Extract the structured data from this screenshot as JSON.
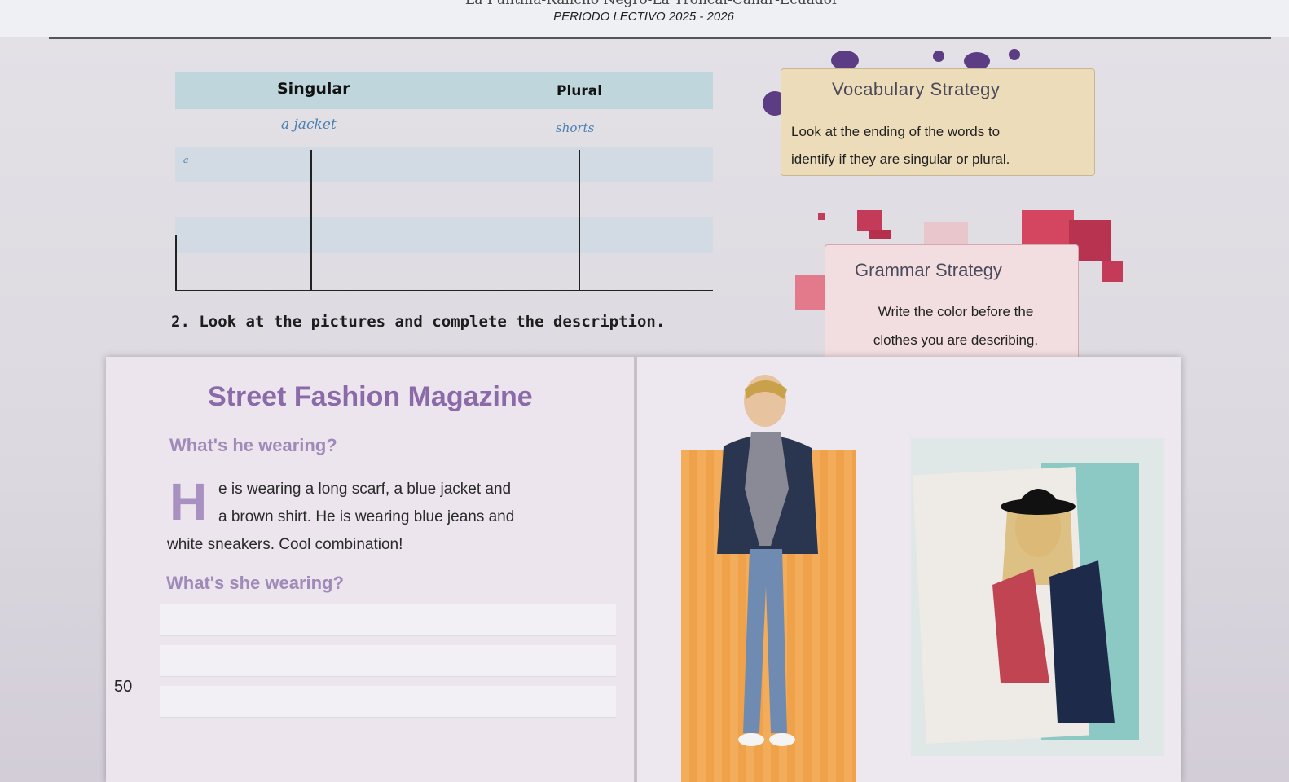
{
  "header": {
    "school_line": "La Puntilla-Rancho Negro-La Troncal-Cañar-Ecuador",
    "periodo": "PERIODO LECTIVO 2025 - 2026"
  },
  "table": {
    "col_singular": "Singular",
    "col_plural": "Plural",
    "example_singular": "a jacket",
    "example_plural": "shorts",
    "row_prefix": "a"
  },
  "vocab_strategy": {
    "title": "Vocabulary  Strategy",
    "line1": "Look at the ending of the words to",
    "line2": "identify if they are singular or plural."
  },
  "grammar_strategy": {
    "title": "Grammar  Strategy",
    "line1": "Write the color before the",
    "line2": "clothes you are describing."
  },
  "instruction": "2. Look at the pictures and complete the description.",
  "magazine": {
    "title": "Street Fashion Magazine",
    "question_he": "What's he wearing?",
    "dropcap": "H",
    "para_line1": "e is wearing a long scarf, a blue jacket and",
    "para_line2": "a brown shirt. He is wearing blue jeans and",
    "para_line3": "white sneakers. Cool combination!",
    "question_she": "What's she wearing?"
  },
  "page_number": "50",
  "colors": {
    "table_header": "#bfd6dc",
    "vocab_box": "#ecdcb9",
    "grammar_box": "#f2dde0",
    "magazine_title": "#8a6aa8",
    "accent_dots": "#5c3c82",
    "accent_squares": "#c43b5a"
  }
}
